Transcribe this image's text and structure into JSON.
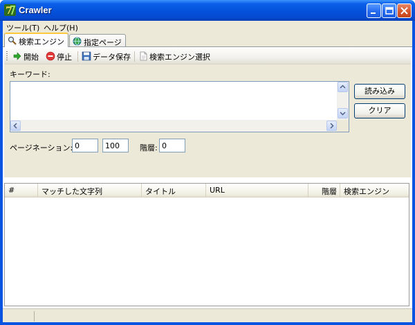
{
  "window": {
    "title": "Crawler"
  },
  "menu": [
    {
      "label": "ツール(T)"
    },
    {
      "label": "ヘルプ(H)"
    }
  ],
  "tabs": [
    {
      "label": "検索エンジン",
      "icon": "magnifier-icon",
      "active": true
    },
    {
      "label": "指定ページ",
      "icon": "globe-icon",
      "active": false
    }
  ],
  "toolbar": {
    "start_label": "開始",
    "stop_label": "停止",
    "save_label": "データ保存",
    "engine_select_label": "検索エンジン選択"
  },
  "form": {
    "keyword_label": "キーワード:",
    "keyword_value": "",
    "load_button": "読み込み",
    "clear_button": "クリア",
    "pagination_label": "ページネーション:",
    "pagination_start": "0",
    "pagination_end": "100",
    "depth_label": "階層:",
    "depth_value": "0"
  },
  "table": {
    "columns": [
      "#",
      "マッチした文字列",
      "タイトル",
      "URL",
      "階層",
      "検索エンジン"
    ],
    "rows": []
  },
  "colors": {
    "title_bar": "#0553dc",
    "face": "#ece9d8",
    "tab_highlight": "#ffc83c"
  }
}
